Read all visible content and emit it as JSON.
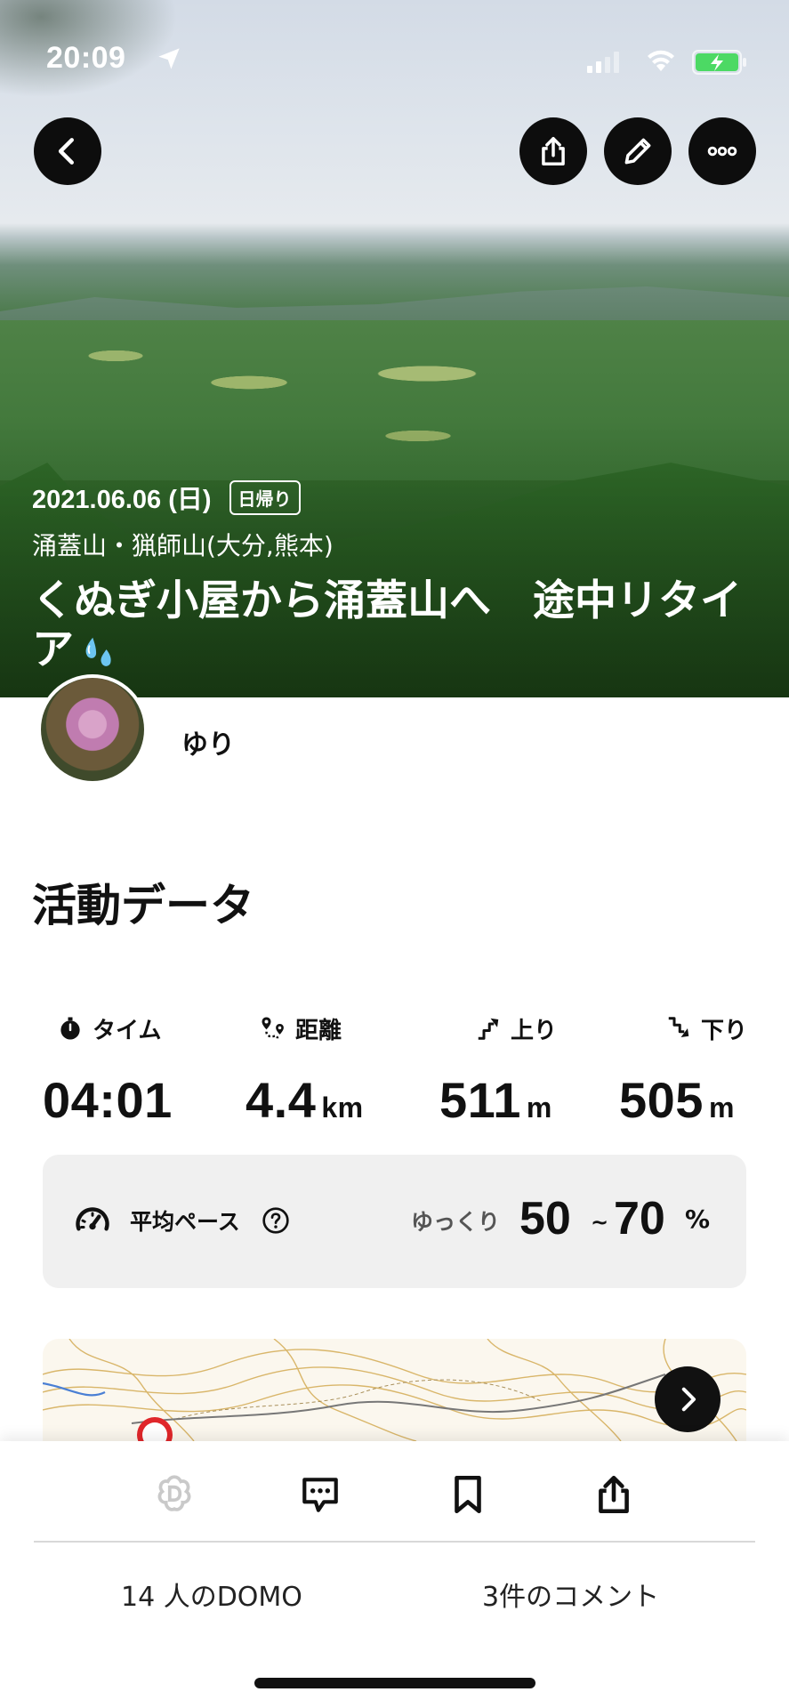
{
  "status_bar": {
    "time": "20:09",
    "icons": [
      "location-arrow-icon",
      "cellular-signal-icon",
      "wifi-icon",
      "battery-charging-icon"
    ]
  },
  "header": {
    "buttons": [
      {
        "name": "back",
        "icon": "chevron-left-icon"
      },
      {
        "name": "share",
        "icon": "share-icon"
      },
      {
        "name": "edit",
        "icon": "pencil-icon"
      },
      {
        "name": "more",
        "icon": "more-dots-icon"
      }
    ]
  },
  "activity": {
    "date": "2021.06.06 (日)",
    "type_badge": "日帰り",
    "area": "涌蓋山・猟師山(大分,熊本)",
    "title": "くぬぎ小屋から涌蓋山へ　途中リタイア",
    "title_emoji": "sweat-droplets-icon"
  },
  "user": {
    "name": "ゆり"
  },
  "activity_data": {
    "section_title": "活動データ",
    "stats": [
      {
        "label": "タイム",
        "value": "04:01",
        "unit": "",
        "icon": "stopwatch-icon"
      },
      {
        "label": "距離",
        "value": "4.4",
        "unit": "km",
        "icon": "route-icon"
      },
      {
        "label": "上り",
        "value": "511",
        "unit": "m",
        "icon": "ascent-icon"
      },
      {
        "label": "下り",
        "value": "505",
        "unit": "m",
        "icon": "descent-icon"
      }
    ],
    "pace": {
      "label": "平均ペース",
      "rating": "ゆっくり",
      "from": "50",
      "separator": "~",
      "to": "70",
      "unit": "%"
    }
  },
  "bottom_bar": {
    "actions": [
      "domo-icon",
      "comment-icon",
      "bookmark-icon",
      "share-icon"
    ],
    "domo_count": "14 人のDOMO",
    "comment_count": "3件のコメント"
  },
  "colors": {
    "button_dark": "#0d0d0d",
    "pace_bg": "#f0f0f0",
    "battery_green": "#4cd964",
    "map_contour": "#d9b66a",
    "map_start": "#e0262a"
  }
}
